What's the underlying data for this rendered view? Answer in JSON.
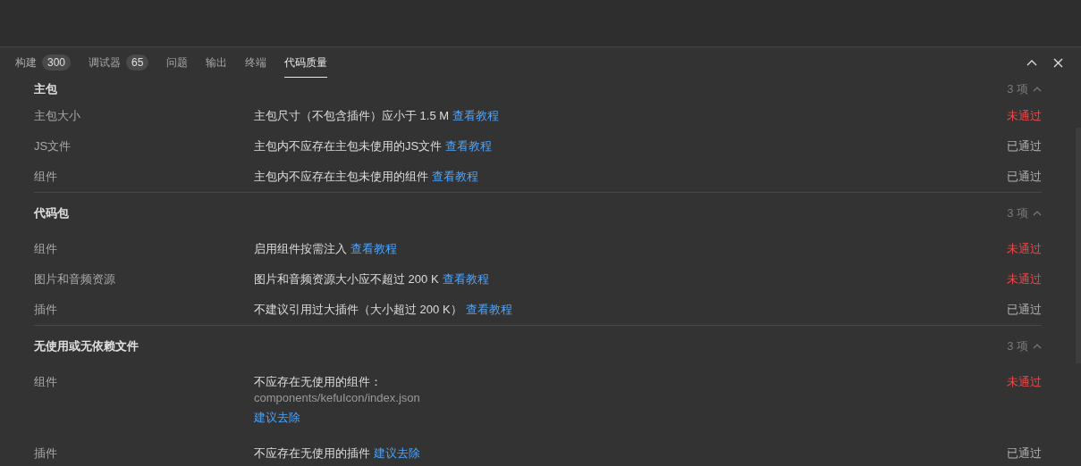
{
  "tabs": [
    {
      "label": "构建",
      "badge": "300",
      "selected": false
    },
    {
      "label": "调试器",
      "badge": "65",
      "selected": false
    },
    {
      "label": "问题",
      "selected": false
    },
    {
      "label": "输出",
      "selected": false
    },
    {
      "label": "终端",
      "selected": false
    },
    {
      "label": "代码质量",
      "selected": true
    }
  ],
  "sections": [
    {
      "title": "主包",
      "count": "3 项",
      "rows": [
        {
          "name": "主包大小",
          "description": "主包尺寸（不包含插件）应小于 1.5 M",
          "link": "查看教程",
          "status": "未通过",
          "passed": false
        },
        {
          "name": "JS文件",
          "description": "主包内不应存在主包未使用的JS文件",
          "link": "查看教程",
          "status": "已通过",
          "passed": true
        },
        {
          "name": "组件",
          "description": "主包内不应存在主包未使用的组件",
          "link": "查看教程",
          "status": "已通过",
          "passed": true
        }
      ]
    },
    {
      "title": "代码包",
      "count": "3 项",
      "rows": [
        {
          "name": "组件",
          "description": "启用组件按需注入",
          "link": "查看教程",
          "status": "未通过",
          "passed": false
        },
        {
          "name": "图片和音频资源",
          "description": "图片和音频资源大小应不超过 200 K",
          "link": "查看教程",
          "status": "未通过",
          "passed": false
        },
        {
          "name": "插件",
          "description": "不建议引用过大插件（大小超过 200 K）",
          "link": "查看教程",
          "status": "已通过",
          "passed": true
        }
      ]
    },
    {
      "title": "无使用或无依赖文件",
      "count": "3 项",
      "rows": [
        {
          "name": "组件",
          "description": "不应存在无使用的组件：",
          "path": "components/kefuIcon/index.json",
          "link": "建议去除",
          "status": "未通过",
          "passed": false
        },
        {
          "name": "插件",
          "description": "不应存在无使用的插件",
          "link": "建议去除",
          "status": "已通过",
          "passed": true
        }
      ]
    }
  ]
}
